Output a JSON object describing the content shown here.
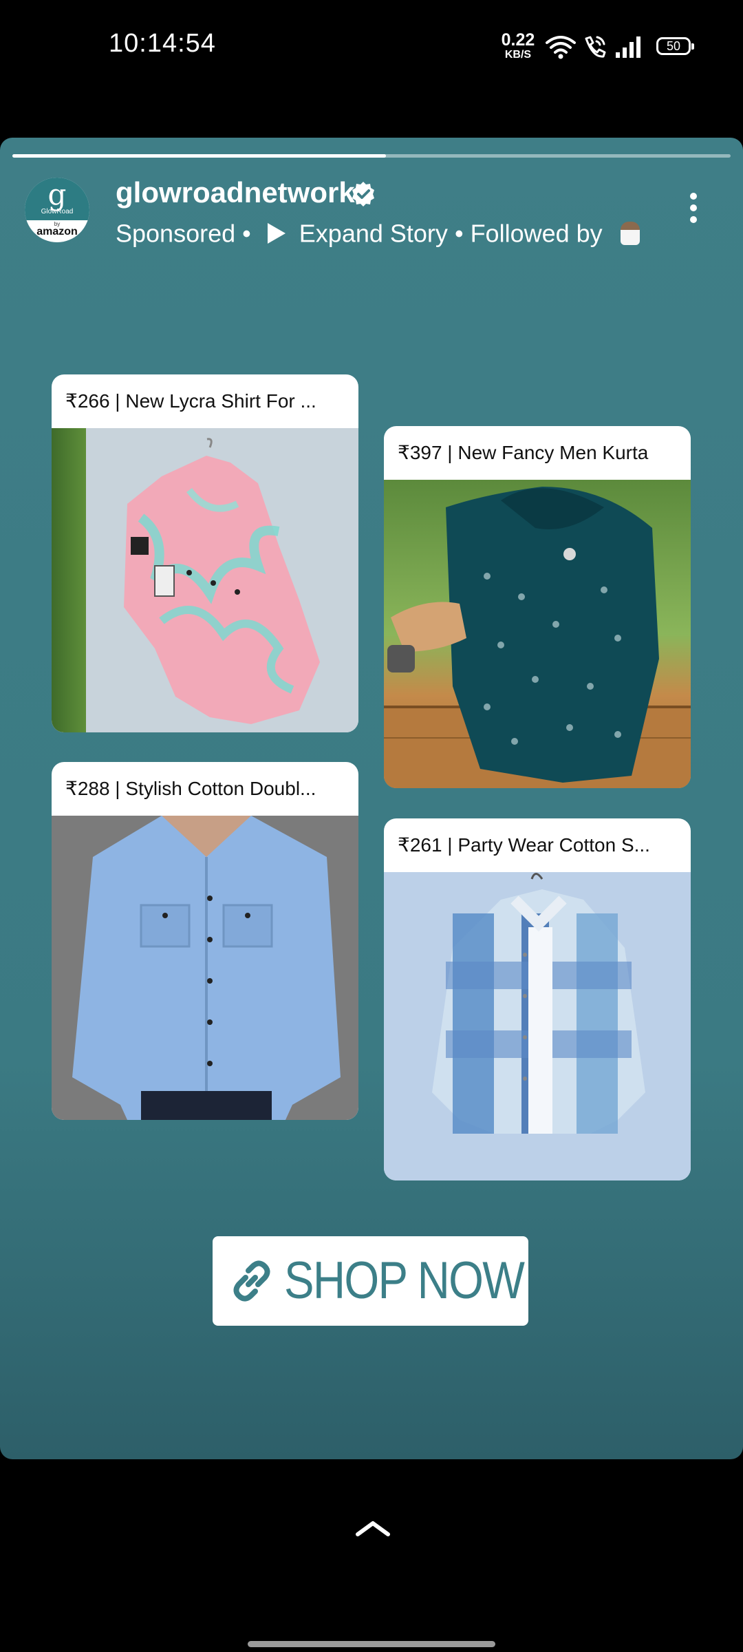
{
  "status_bar": {
    "time": "10:14:54",
    "net_speed_value": "0.22",
    "net_speed_unit": "KB/S",
    "battery": "50",
    "icons": [
      "wifi-icon",
      "wifi-call-icon",
      "signal-icon",
      "battery-icon"
    ]
  },
  "story": {
    "progress": 0.52,
    "avatar": {
      "mark": "g",
      "brand": "GlowRoad",
      "by": "by",
      "parent": "amazon"
    },
    "username": "glowroadnetwork",
    "verified": true,
    "sponsored": "Sponsored",
    "separator": "•",
    "expand": "Expand Story",
    "followed_by": "Followed by",
    "products": [
      {
        "label": "₹266 | New Lycra Shirt For ...",
        "image": "pink-floral-shirt-photo"
      },
      {
        "label": "₹397 | New Fancy Men Kurta",
        "image": "teal-embroidered-kurta-photo"
      },
      {
        "label": "₹288 | Stylish Cotton Doubl...",
        "image": "light-blue-denim-shirt-photo"
      },
      {
        "label": "₹261 | Party Wear Cotton S...",
        "image": "blue-check-shirt-photo"
      }
    ],
    "cta": "SHOP NOW"
  },
  "colors": {
    "story_bg": "#3f7e87",
    "cta_text": "#3c7f88",
    "verified_badge": "#ffffff"
  }
}
